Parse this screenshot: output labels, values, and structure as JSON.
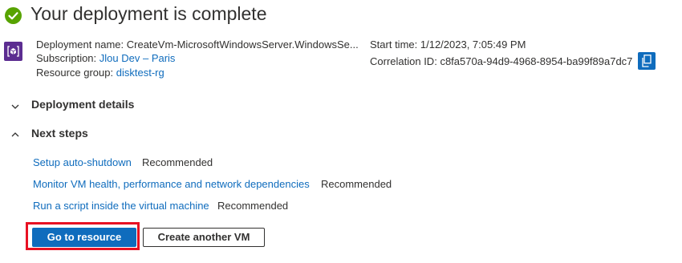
{
  "header": {
    "title": "Your deployment is complete",
    "status_icon": "success-check-icon",
    "status_color": "#57a300"
  },
  "deployment": {
    "name_label": "Deployment name:",
    "name_value": "CreateVm-MicrosoftWindowsServer.WindowsSe...",
    "subscription_label": "Subscription:",
    "subscription_value": "Jlou Dev – Paris",
    "resource_group_label": "Resource group:",
    "resource_group_value": "disktest-rg",
    "start_time_label": "Start time:",
    "start_time_value": "1/12/2023, 7:05:49 PM",
    "correlation_label": "Correlation ID:",
    "correlation_value": "c8fa570a-94d9-4968-8954-ba99f89a7dc7",
    "resource_icon": "deployment-cube-icon",
    "copy_icon": "copy-icon"
  },
  "sections": {
    "details_label": "Deployment details",
    "details_expanded": false,
    "next_steps_label": "Next steps",
    "next_steps_expanded": true
  },
  "next_steps": [
    {
      "link": "Setup auto-shutdown",
      "tag": "Recommended"
    },
    {
      "link": "Monitor VM health, performance and network dependencies",
      "tag": "Recommended"
    },
    {
      "link": "Run a script inside the virtual machine",
      "tag": "Recommended"
    }
  ],
  "actions": {
    "primary": "Go to resource",
    "secondary": "Create another VM"
  },
  "colors": {
    "accent": "#0f6cbd",
    "highlight": "#e81123",
    "resource_icon_bg": "#5c2d91"
  }
}
